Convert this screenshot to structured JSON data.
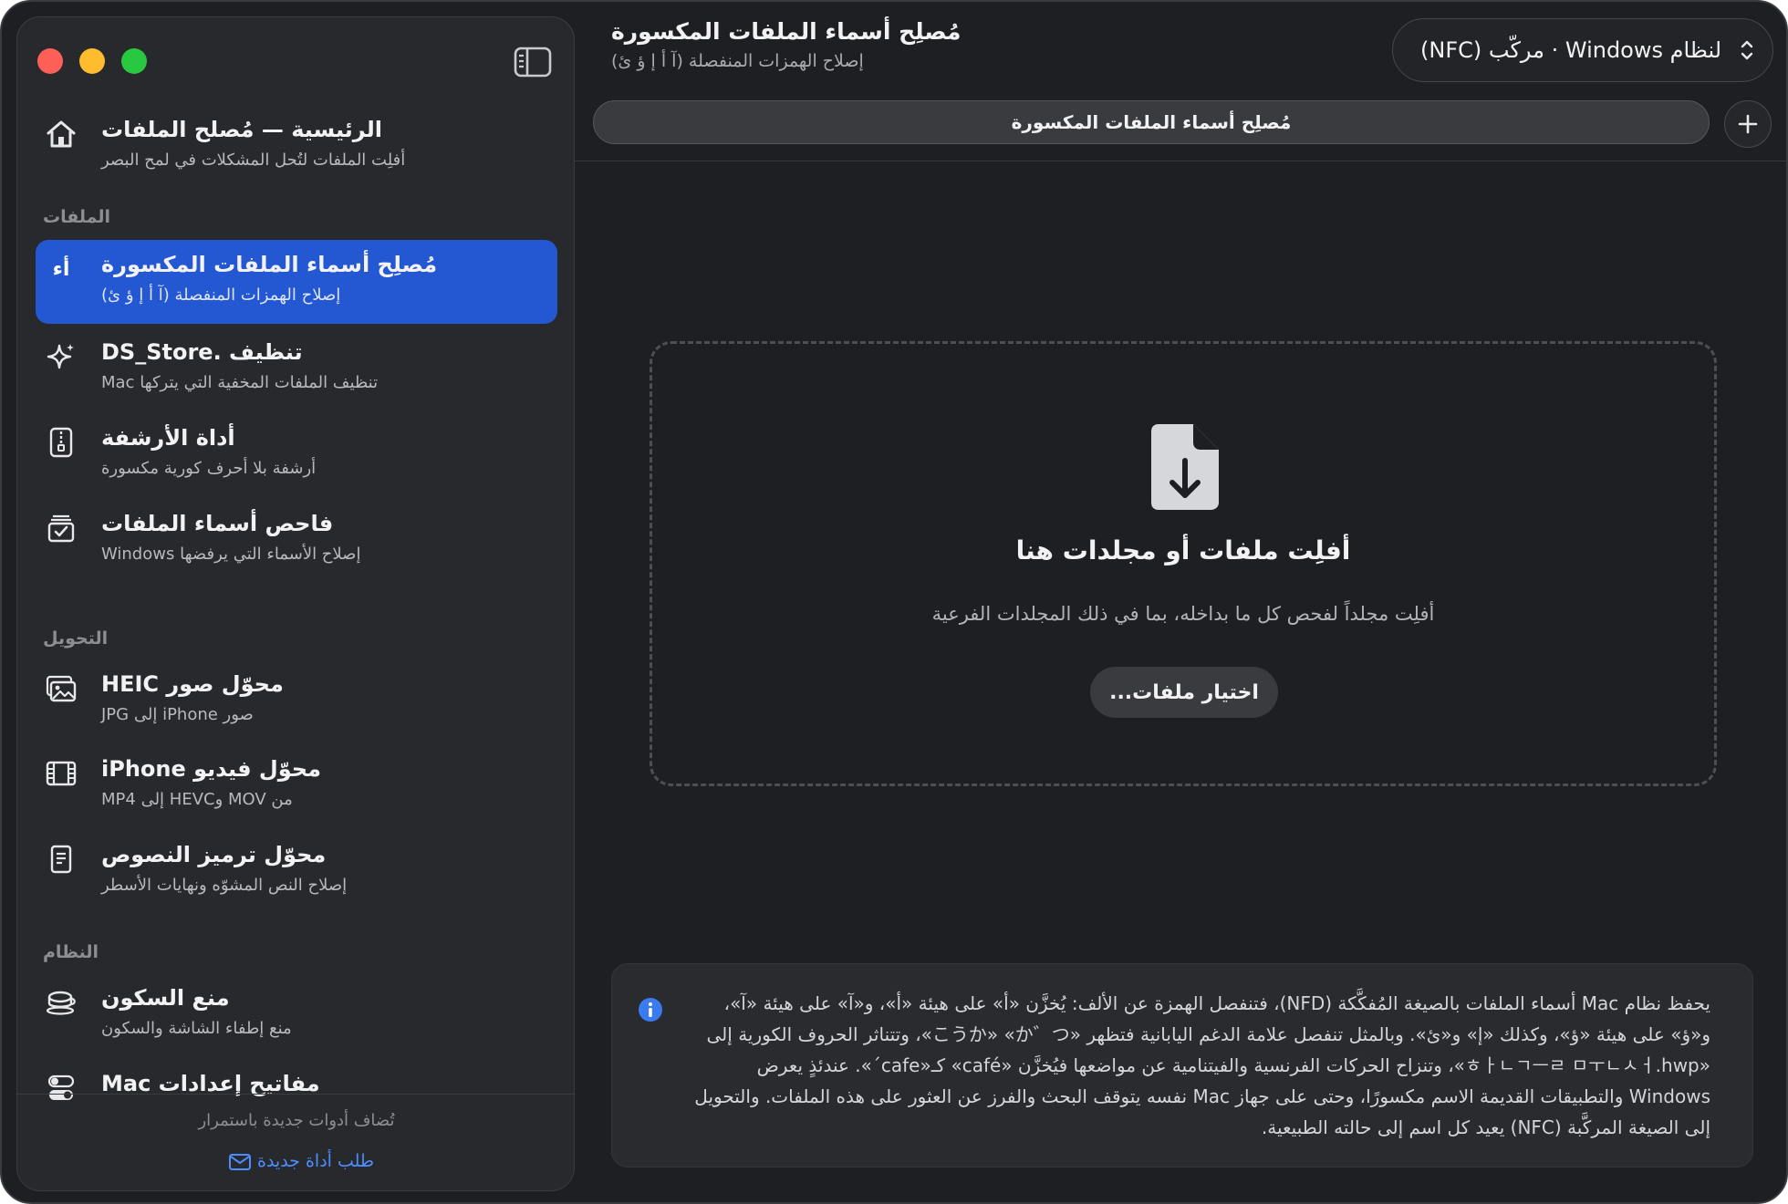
{
  "window": {
    "title": "مُصلِح أسماء الملفات المكسورة"
  },
  "sidebar": {
    "home": {
      "title": "الرئيسية — مُصلح الملفات",
      "subtitle": "أفلِت الملفات لتُحل المشكلات في لمح البصر"
    },
    "sections": [
      {
        "label": "الملفات"
      },
      {
        "label": "التحويل"
      },
      {
        "label": "النظام"
      }
    ],
    "items": [
      {
        "title": "مُصلِح أسماء الملفات المكسورة",
        "subtitle": "إصلاح الهمزات المنفصلة (آ أ إ ؤ ئ)",
        "icon": "arabic-letters-icon",
        "icon_text": "أء",
        "selected": true
      },
      {
        "title": "تنظيف .DS_Store",
        "subtitle": "تنظيف الملفات المخفية التي يتركها Mac",
        "icon": "sparkles-icon"
      },
      {
        "title": "أداة الأرشفة",
        "subtitle": "أرشفة بلا أحرف كورية مكسورة",
        "icon": "zip-file-icon"
      },
      {
        "title": "فاحص أسماء الملفات",
        "subtitle": "إصلاح الأسماء التي يرفضها Windows",
        "icon": "checklist-icon"
      },
      {
        "title": "محوّل صور HEIC",
        "subtitle": "صور iPhone إلى JPG",
        "icon": "photos-icon"
      },
      {
        "title": "محوّل فيديو iPhone",
        "subtitle": "من MOV وHEVC إلى MP4",
        "icon": "film-icon"
      },
      {
        "title": "محوّل ترميز النصوص",
        "subtitle": "إصلاح النص المشوّه ونهايات الأسطر",
        "icon": "document-text-icon"
      },
      {
        "title": "منع السكون",
        "subtitle": "منع إطفاء الشاشة والسكون",
        "icon": "coffee-cup-icon"
      },
      {
        "title": "مفاتيح إعدادات Mac",
        "subtitle": "",
        "icon": "toggles-icon"
      }
    ],
    "footer": {
      "note": "تُضاف أدوات جديدة باستمرار",
      "link": "طلب أداة جديدة"
    }
  },
  "header": {
    "title": "مُصلِح أسماء الملفات المكسورة",
    "subtitle": "إصلاح الهمزات المنفصلة (آ أ إ ؤ ئ)",
    "encoding": "لنظام Windows · مركّب (NFC)"
  },
  "tabs": [
    {
      "label": "مُصلِح أسماء الملفات المكسورة"
    }
  ],
  "dropzone": {
    "title": "أفلِت ملفات أو مجلدات هنا",
    "subtitle": "أفلِت مجلداً لفحص كل ما بداخله، بما في ذلك المجلدات الفرعية",
    "button": "اختيار ملفات..."
  },
  "info": {
    "text": "يحفظ نظام Mac أسماء الملفات بالصيغة المُفكَّكة (NFD)، فتنفصل الهمزة عن الألف: يُخزَّن «أ» على هيئة «أ»، و«آ» على هيئة «آ»، و«ؤ» على هيئة «ؤ»، وكذلك «إ» و«ئ». وبالمثل تنفصل علامة الدغم اليابانية فتظهر «こうか» «か゛つ»، وتتناثر الحروف الكورية إلى «ㅎㅏㄴㄱㅡㄹ ㅁㅜㄴㅅㅓ.hwp»، وتنزاح الحركات الفرنسية والفيتنامية عن مواضعها فيُخزَّن «café» كـ«cafe´». عندئذٍ يعرض Windows والتطبيقات القديمة الاسم مكسورًا، وحتى على جهاز Mac نفسه يتوقف البحث والفرز عن العثور على هذه الملفات. والتحويل إلى الصيغة المركَّبة (NFC) يعيد كل اسم إلى حالته الطبيعية."
  },
  "colors": {
    "accent": "#2458d3",
    "link": "#4c8dff",
    "window_bg": "#1e1f22",
    "sidebar_bg": "#28292d"
  }
}
